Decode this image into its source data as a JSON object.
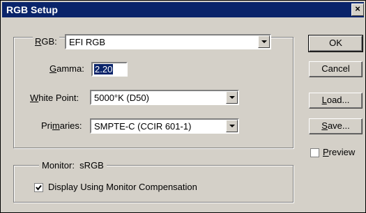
{
  "window": {
    "title": "RGB Setup",
    "close_glyph": "×"
  },
  "rgb": {
    "legend_prefix": "",
    "label_hot": "R",
    "label_rest": "GB:",
    "value": "EFI RGB"
  },
  "gamma": {
    "label_hot": "G",
    "label_rest": "amma:",
    "value": "2.20"
  },
  "white_point": {
    "label_hot": "W",
    "label_rest": "hite Point:",
    "value": "5000°K (D50)"
  },
  "primaries": {
    "label_pre": "Pri",
    "label_hot": "m",
    "label_rest": "aries:",
    "value": "SMPTE-C (CCIR 601-1)"
  },
  "monitor": {
    "label": "Monitor:  sRGB",
    "compensation_label": "Display Using Monitor Compensation",
    "compensation_checked": true
  },
  "buttons": {
    "ok": "OK",
    "cancel": "Cancel",
    "load_hot": "L",
    "load_rest": "oad...",
    "save_hot": "S",
    "save_rest": "ave..."
  },
  "preview": {
    "label_hot": "P",
    "label_rest": "review",
    "checked": false
  }
}
